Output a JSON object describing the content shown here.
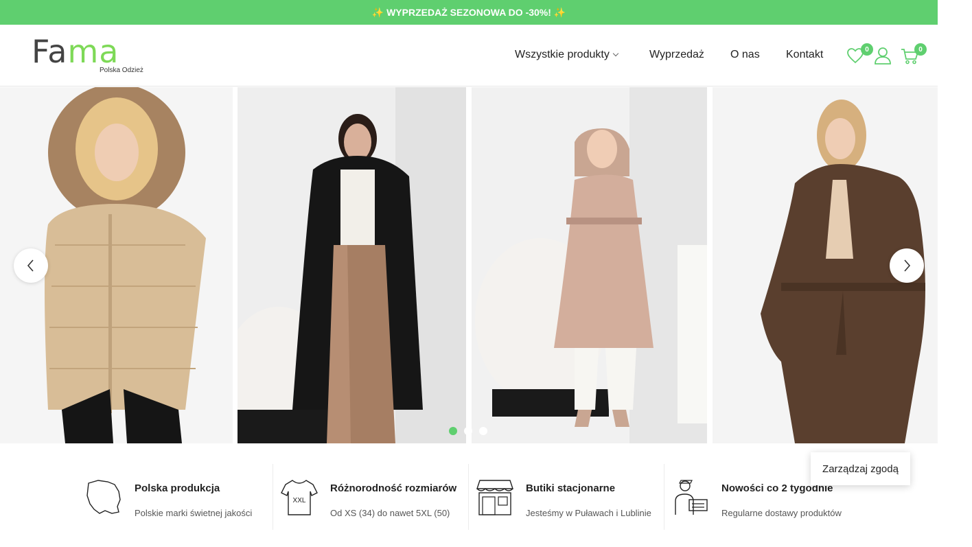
{
  "promo": {
    "text": "✨ WYPRZEDAŻ SEZONOWA DO -30%! ✨"
  },
  "header": {
    "logo_word_a": "Fa",
    "logo_word_b": "ma",
    "logo_sub": "Polska Odzież",
    "nav": [
      {
        "label": "Wszystkie produkty"
      },
      {
        "label": "Wyprzedaż"
      },
      {
        "label": "O nas"
      },
      {
        "label": "Kontakt"
      }
    ],
    "wishlist_count": "0",
    "cart_count": "0"
  },
  "slider": {
    "slides": [
      {
        "icon": "beige-puffer-jacket-with-fur-hood"
      },
      {
        "icon": "black-long-quilted-coat"
      },
      {
        "icon": "pink-hooded-coat-with-belt"
      },
      {
        "icon": "brown-wool-belted-coat"
      }
    ],
    "dots": 3,
    "active_dot": 0
  },
  "features": [
    {
      "title": "Polska produkcja",
      "desc": "Polskie marki świetnej jakości",
      "icon": "poland-map-icon"
    },
    {
      "title": "Różnorodność rozmiarów",
      "desc": "Od XS (34) do nawet 5XL (50)",
      "icon": "tshirt-xxl-icon",
      "icon_text": "XXL"
    },
    {
      "title": "Butiki stacjonarne",
      "desc": "Jesteśmy w Puławach i Lublinie",
      "icon": "storefront-icon"
    },
    {
      "title": "Nowości co 2 tygodnie",
      "desc": "Regularne dostawy produktów",
      "icon": "delivery-person-icon"
    }
  ],
  "consent": {
    "label": "Zarządzaj zgodą"
  },
  "colors": {
    "accent": "#5fcf6f",
    "logo_green": "#7ed957"
  }
}
